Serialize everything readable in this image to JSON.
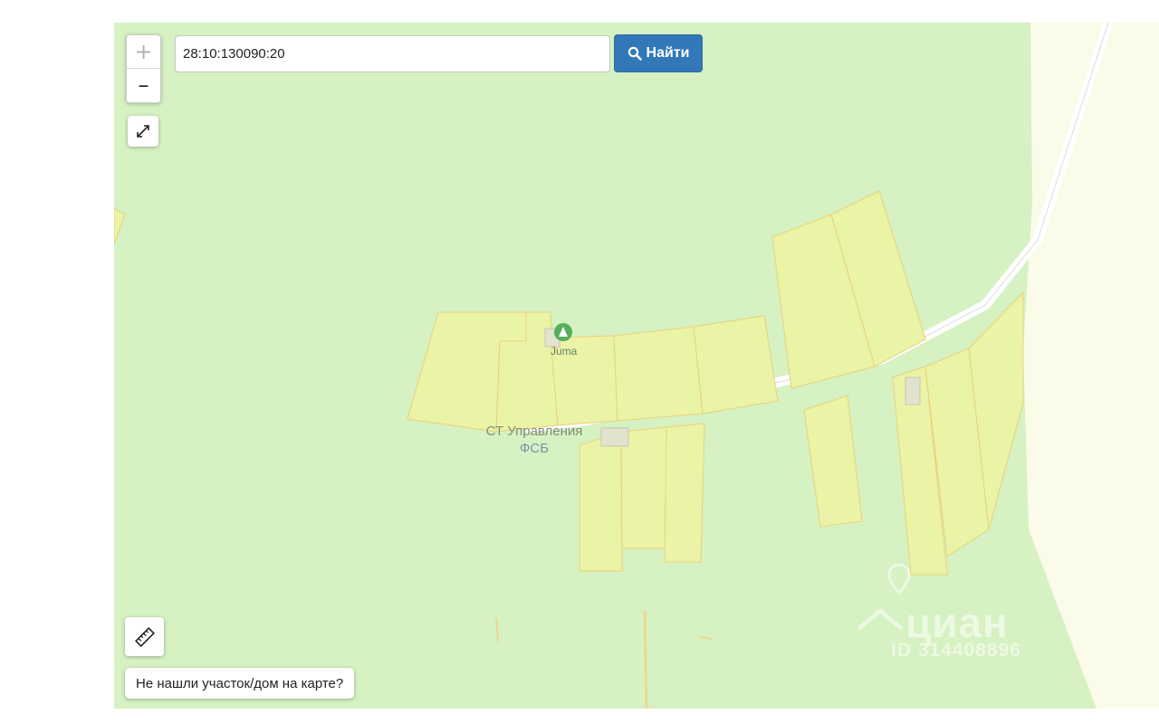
{
  "search": {
    "value": "28:10:130090:20",
    "button_label": "Найти"
  },
  "map": {
    "zoom_in_label": "+",
    "zoom_out_label": "–",
    "settlement_label_line1": "СТ Управления",
    "settlement_label_line2": "ФСБ",
    "poi_label": "Juma",
    "colors": {
      "land": "#d6f1c2",
      "parcel_fill": "#ebf3a6",
      "parcel_stroke": "#e8d27a",
      "road": "#fdfae6",
      "unmapped": "#fbfbea",
      "button_blue": "#3278b8"
    }
  },
  "help": {
    "label": "Не нашли участок/дом на карте?"
  },
  "watermark": {
    "brand": "циан",
    "id_text": "ID 314408896"
  },
  "icons": [
    "search-icon",
    "fullscreen-icon",
    "ruler-icon",
    "camp-icon",
    "location-pin-icon"
  ]
}
